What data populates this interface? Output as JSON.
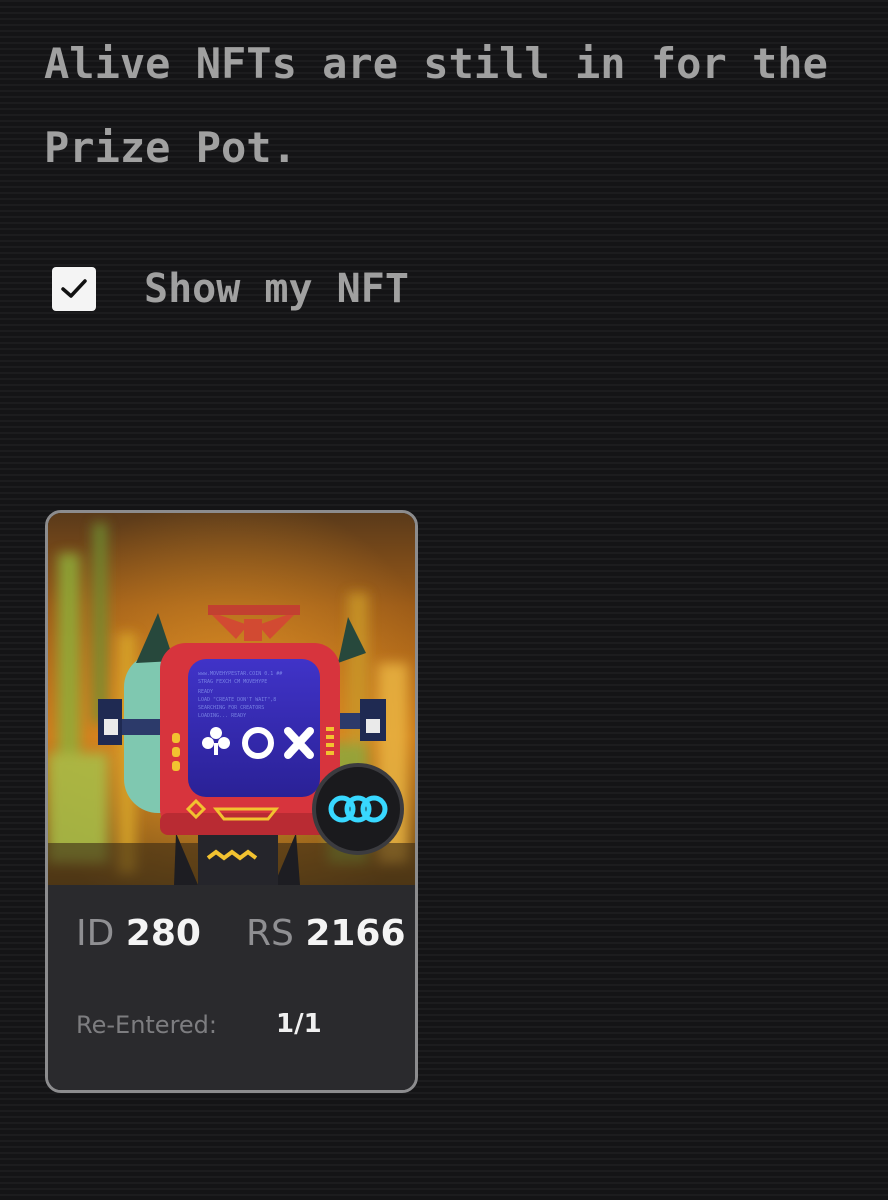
{
  "intro": {
    "line1": "Alive NFTs are still in for the",
    "line2": "Prize Pot."
  },
  "toggle": {
    "label": "Show my NFT",
    "checked": true
  },
  "nft_card": {
    "id_label": "ID",
    "id_value": "280",
    "rs_label": "RS",
    "rs_value": "2166",
    "reentered_label": "Re-Entered:",
    "reentered_value": "1/1",
    "badge_icon": "infinity-chain-icon"
  },
  "colors": {
    "background": "#141416",
    "text": "#b9b9b9",
    "card_border": "#8c8c8e",
    "card_info_bg": "#2a2a2d",
    "tv_body": "#d8343c",
    "tv_screen": "#3a2fb8",
    "badge_ring": "#38d8ff"
  }
}
